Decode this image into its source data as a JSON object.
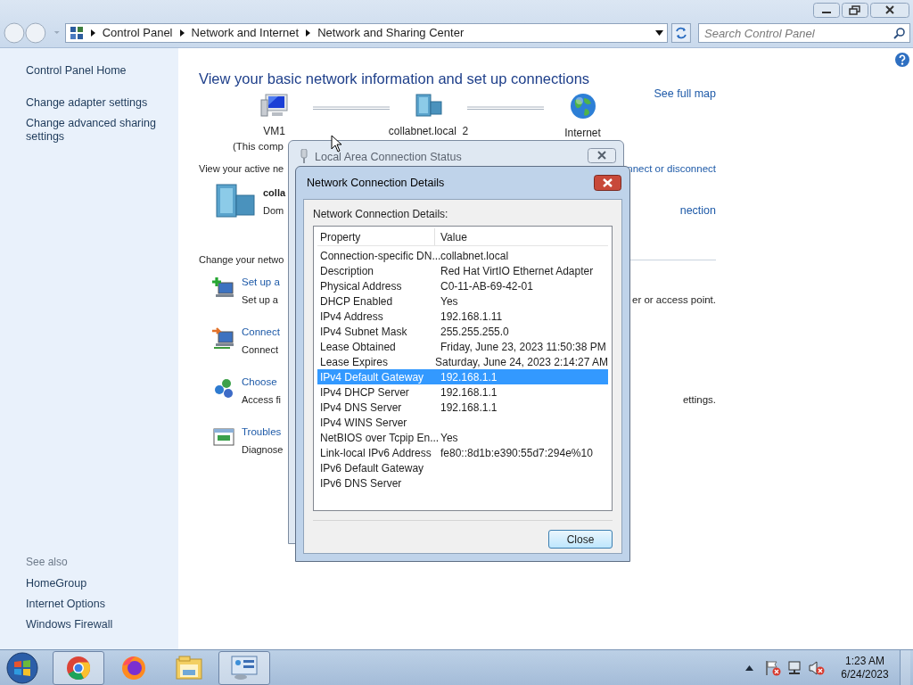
{
  "address_bar": {
    "breadcrumbs": [
      "Control Panel",
      "Network and Internet",
      "Network and Sharing Center"
    ],
    "search": {
      "placeholder": "Search Control Panel"
    }
  },
  "sidebar": {
    "links": [
      "Control Panel Home",
      "Change adapter settings",
      "Change advanced sharing settings"
    ],
    "see_also": {
      "heading": "See also",
      "links": [
        "HomeGroup",
        "Internet Options",
        "Windows Firewall"
      ]
    }
  },
  "main": {
    "heading": "View your basic network information and set up connections",
    "map": [
      {
        "kind": "computer",
        "label": "VM1",
        "sublabel": "(This comp"
      },
      {
        "kind": "domain",
        "label": "collabnet.local  2"
      },
      {
        "kind": "internet",
        "label": "Internet"
      }
    ],
    "see_full_map": "See full map",
    "active_label": "View your active ne",
    "active_link": "nnect or disconnect",
    "network": {
      "name": "colla",
      "type": "Dom",
      "link": "nection"
    },
    "change_label": "Change your netwo",
    "tasks": [
      {
        "kind": "add",
        "title": "Set up a",
        "description": "Set up a",
        "tail": "er or access point."
      },
      {
        "kind": "connect",
        "title": "Connect",
        "description": "Connect"
      },
      {
        "kind": "homegroup",
        "title": "Choose",
        "description": "Access fi",
        "tail": "ettings."
      },
      {
        "kind": "troubleshoot",
        "title": "Troubles",
        "description": "Diagnose"
      }
    ]
  },
  "status_window": {
    "title": "Local Area Connection Status"
  },
  "details": {
    "title": "Network Connection Details",
    "label": "Network Connection Details:",
    "columns": [
      "Property",
      "Value"
    ],
    "rows": [
      {
        "property": "Connection-specific DN...",
        "value": "collabnet.local",
        "selected": false
      },
      {
        "property": "Description",
        "value": "Red Hat VirtIO Ethernet Adapter",
        "selected": false
      },
      {
        "property": "Physical Address",
        "value": "C0-11-AB-69-42-01",
        "selected": false
      },
      {
        "property": "DHCP Enabled",
        "value": "Yes",
        "selected": false
      },
      {
        "property": "IPv4 Address",
        "value": "192.168.1.11",
        "selected": false
      },
      {
        "property": "IPv4 Subnet Mask",
        "value": "255.255.255.0",
        "selected": false
      },
      {
        "property": "Lease Obtained",
        "value": "Friday, June 23, 2023 11:50:38 PM",
        "selected": false
      },
      {
        "property": "Lease Expires",
        "value": "Saturday, June 24, 2023 2:14:27 AM",
        "selected": false
      },
      {
        "property": "IPv4 Default Gateway",
        "value": "192.168.1.1",
        "selected": true
      },
      {
        "property": "IPv4 DHCP Server",
        "value": "192.168.1.1",
        "selected": false
      },
      {
        "property": "IPv4 DNS Server",
        "value": "192.168.1.1",
        "selected": false
      },
      {
        "property": "IPv4 WINS Server",
        "selected": false
      },
      {
        "property": "NetBIOS over Tcpip En...",
        "value": "Yes",
        "selected": false
      },
      {
        "property": "Link-local IPv6 Address",
        "value": "fe80::8d1b:e390:55d7:294e%10",
        "selected": false
      },
      {
        "property": "IPv6 Default Gateway",
        "selected": false
      },
      {
        "property": "IPv6 DNS Server",
        "selected": false
      }
    ],
    "close_button": "Close"
  },
  "taskbar": {
    "apps": [
      {
        "kind": "chrome",
        "running": true
      },
      {
        "kind": "firefox",
        "running": false
      },
      {
        "kind": "explorer",
        "running": false
      },
      {
        "kind": "control-panel",
        "running": true
      }
    ],
    "time": "1:23 AM",
    "date": "6/24/2023"
  }
}
